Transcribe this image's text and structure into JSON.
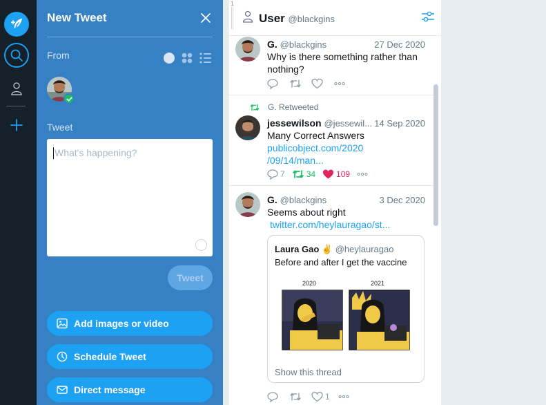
{
  "compose": {
    "title": "New Tweet",
    "from_label": "From",
    "tweet_label": "Tweet",
    "placeholder": "What's happening?",
    "tweet_button": "Tweet",
    "actions": [
      {
        "label": "Add images or video",
        "icon": "image-icon"
      },
      {
        "label": "Schedule Tweet",
        "icon": "clock-icon"
      },
      {
        "label": "Direct message",
        "icon": "mail-icon"
      }
    ]
  },
  "column": {
    "title": "User",
    "handle": "@blackgins",
    "index": "1"
  },
  "tweets": [
    {
      "name": "G.",
      "handle": "@blackgins",
      "date": "27 Dec 2020",
      "text": "Why is there something rather than nothing?"
    },
    {
      "retweet_label": "G. Retweeted",
      "name": "jessewilson",
      "handle": "@jessewil...",
      "date": "14 Sep 2020",
      "text": "Many Correct Answers",
      "link_line1": "publicobject.com/2020",
      "link_line2": "/09/14/man...",
      "reply_count": "7",
      "retweet_count": "34",
      "like_count": "109"
    },
    {
      "name": "G.",
      "handle": "@blackgins",
      "date": "3 Dec 2020",
      "text": "Seems about right",
      "link": "twitter.com/heylauragao/st...",
      "like_count": "1",
      "quote": {
        "name": "Laura Gao ✌️",
        "handle": "@heylauragao",
        "text": "Before and after I get the vaccine",
        "panel_left": "2020",
        "panel_right": "2021",
        "show_thread": "Show this thread"
      }
    }
  ],
  "colors": {
    "accent": "#1da1f2",
    "compose_bg": "#3581c4",
    "rail_bg": "#15202b",
    "retweet_green": "#17bf63",
    "like_red": "#e0245e"
  }
}
